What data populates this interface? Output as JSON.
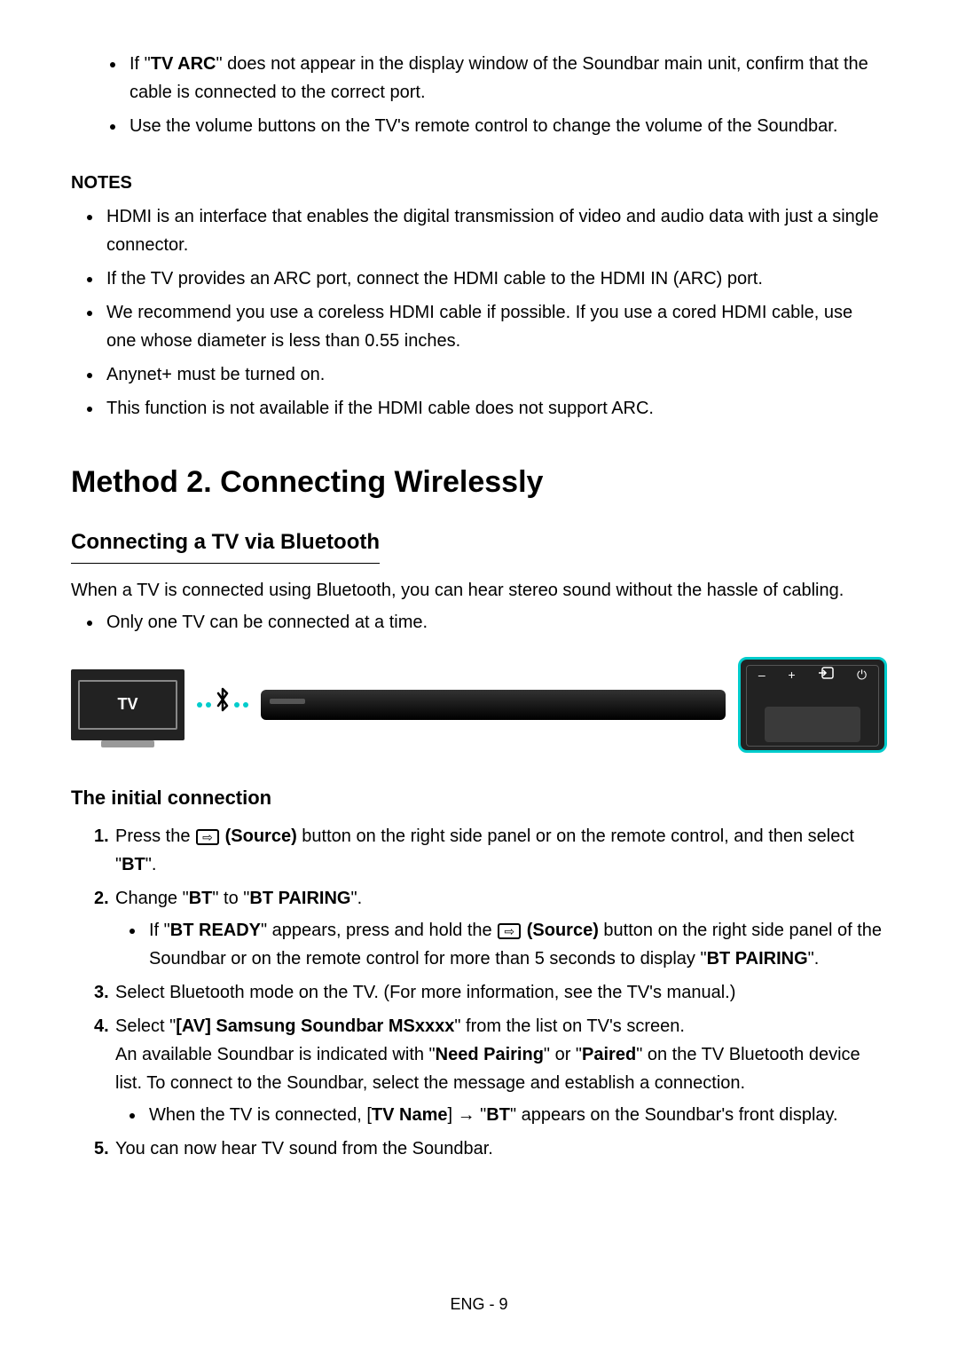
{
  "top_bullets": {
    "b1_a": "If \"",
    "b1_bold": "TV ARC",
    "b1_b": "\" does not appear in the display window of the Soundbar main unit, confirm that the cable is connected to the correct port.",
    "b2": "Use the volume buttons on the TV's remote control to change the volume of the Soundbar."
  },
  "notes": {
    "heading": "NOTES",
    "items": [
      "HDMI is an interface that enables the digital transmission of video and audio data with just a single connector.",
      "If the TV provides an ARC port, connect the HDMI cable to the HDMI IN (ARC) port.",
      "We recommend you use a coreless HDMI cable if possible. If you use a cored HDMI cable, use one whose diameter is less than 0.55 inches.",
      "Anynet+ must be turned on.",
      "This function is not available if the HDMI cable does not support ARC."
    ]
  },
  "method": {
    "heading": "Method 2. Connecting Wirelessly",
    "subhead": "Connecting a TV via Bluetooth",
    "intro": "When a TV is connected using Bluetooth, you can hear stereo sound without the hassle of cabling.",
    "intro_bullet": "Only one TV can be connected at a time."
  },
  "diagram": {
    "tv_label": "TV",
    "side_minus": "–",
    "side_plus": "+",
    "side_power": "⏻"
  },
  "initial": {
    "heading": "The initial connection",
    "step1_a": "Press the ",
    "step1_src": " (Source)",
    "step1_b": " button on the right side panel or on the remote control, and then select \"",
    "step1_bold": "BT",
    "step1_c": "\".",
    "step2_a": "Change \"",
    "step2_b1": "BT",
    "step2_b": "\" to \"",
    "step2_b2": "BT PAIRING",
    "step2_c": "\".",
    "step2_sub_a": "If \"",
    "step2_sub_bold1": "BT READY",
    "step2_sub_b": "\" appears, press and hold the ",
    "step2_sub_src": " (Source)",
    "step2_sub_c": " button on the right side panel of the Soundbar or on the remote control for more than 5 seconds to display \"",
    "step2_sub_bold2": "BT PAIRING",
    "step2_sub_d": "\".",
    "step3": "Select Bluetooth mode on the TV. (For more information, see the TV's manual.)",
    "step4_a": "Select \"",
    "step4_bold1": "[AV] Samsung Soundbar MSxxxx",
    "step4_b": "\" from the list on TV's screen.",
    "step4_line2_a": "An available Soundbar is indicated with \"",
    "step4_line2_b1": "Need Pairing",
    "step4_line2_b": "\" or \"",
    "step4_line2_b2": "Paired",
    "step4_line2_c": "\" on the TV Bluetooth device list. To connect to the Soundbar, select the message and establish a connection.",
    "step4_sub_a": "When the TV is connected, [",
    "step4_sub_bold1": "TV Name",
    "step4_sub_b": "] ",
    "step4_sub_arrow": "→",
    "step4_sub_c": " \"",
    "step4_sub_bold2": "BT",
    "step4_sub_d": "\" appears on the Soundbar's front display.",
    "step5": "You can now hear TV sound from the Soundbar."
  },
  "footer": "ENG - 9"
}
